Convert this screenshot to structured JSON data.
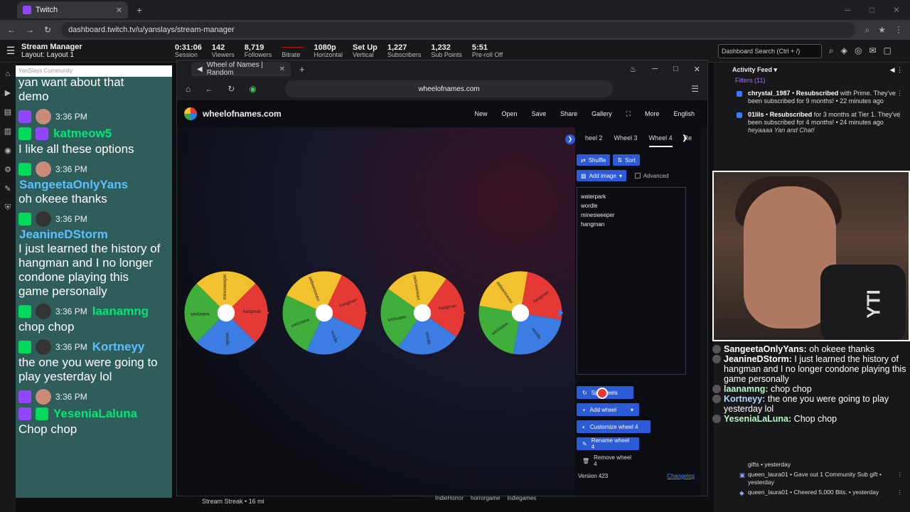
{
  "browser": {
    "tab_title": "Twitch",
    "url": "dashboard.twitch.tv/u/yanslays/stream-manager"
  },
  "header": {
    "title": "Stream Manager",
    "layout": "Layout: Layout 1",
    "stats": [
      {
        "value": "0:31:06",
        "label": "Session"
      },
      {
        "value": "142",
        "label": "Viewers"
      },
      {
        "value": "8,719",
        "label": "Followers"
      },
      {
        "value": "",
        "label": "Bitrate"
      },
      {
        "value": "1080p",
        "label": "Horizontal"
      },
      {
        "value": "Set Up",
        "label": "Vertical"
      },
      {
        "value": "1,227",
        "label": "Subscribers"
      },
      {
        "value": "1,232",
        "label": "Sub Points"
      },
      {
        "value": "5:51",
        "label": "Pre-roll Off"
      }
    ],
    "search_placeholder": "Dashboard Search (Ctrl + /)"
  },
  "chat": {
    "note": "YanSlays Community",
    "partial_text": "demo",
    "partial_top": "yan want about that",
    "messages": [
      {
        "time": "3:36 PM",
        "user": "katmeow5",
        "color": "#00e676",
        "text": "I like all these options"
      },
      {
        "time": "3:36 PM",
        "user": "SangeetaOnlyYans",
        "color": "#5bc0ff",
        "text": "oh okeee thanks"
      },
      {
        "time": "3:36 PM",
        "user": "JeanineDStorm",
        "color": "#5bc0ff",
        "text": "I just learned the history of hangman and I no longer condone playing this game personally"
      },
      {
        "time": "3:36 PM",
        "user": "laanamng",
        "color": "#00e676",
        "text": "chop chop"
      },
      {
        "time": "3:36 PM",
        "user": "Kortneyy",
        "color": "#5bc0ff",
        "text": "the one you were going to play yesterday lol"
      },
      {
        "time": "3:36 PM",
        "user": "YeseniaLaluna",
        "color": "#00e676",
        "text": "Chop chop"
      }
    ]
  },
  "inner_browser": {
    "tab_title": "Wheel of Names | Random",
    "url": "wheelofnames.com",
    "site_name": "wheelofnames.com",
    "menu": [
      "New",
      "Open",
      "Save",
      "Share",
      "Gallery",
      "More",
      "English"
    ],
    "wheel_tabs": [
      "heel 2",
      "Wheel 3",
      "Wheel 4",
      "Re"
    ],
    "shuffle": "Shuffle",
    "sort": "Sort",
    "add_image": "Add image",
    "advanced": "Advanced",
    "entries": [
      "waterpark",
      "wordle",
      "minesweeper",
      "hangman"
    ],
    "spin_wheels": "Sp      wheels",
    "add_wheel": "Add wheel",
    "customize": "Customize wheel 4",
    "rename": "Rename wheel 4",
    "remove": "Remove wheel 4",
    "version": "Version 423",
    "changelog": "Changelog",
    "wheel_labels": [
      "hangman",
      "wordle",
      "waterpark",
      "minesweeper"
    ]
  },
  "feed": {
    "title": "Activity Feed",
    "filters": "Filters (11)",
    "items": [
      {
        "user": "chrystal_1987",
        "action": "Resubscribed",
        "text": "with Prime. They've been subscribed for 9 months! • 22 minutes ago"
      },
      {
        "user": "01lils",
        "action": "Resubscribed",
        "text": "for 3 months at Tier 1. They've been subscribed for 4 months! • 24 minutes ago",
        "quote": "heyaaaa Yan and Chat!"
      }
    ]
  },
  "overlay": [
    {
      "user": "SangeetaOnlyYans:",
      "text": "oh okeee thanks",
      "color": "#ffffff"
    },
    {
      "user": "JeanineDStorm:",
      "text": "I just learned the history of hangman and I no longer condone playing this game personally",
      "color": "#ffffff"
    },
    {
      "user": "laanamng:",
      "text": "chop chop",
      "color": "#b7f7c6"
    },
    {
      "user": "Kortneyy:",
      "text": "the one you were going to play yesterday lol",
      "color": "#b7d4ff"
    },
    {
      "user": "YeseniaLaLuna:",
      "text": "Chop chop",
      "color": "#b7f7c6"
    }
  ],
  "feed_bottom": [
    {
      "text": "gifts • yesterday"
    },
    {
      "text": "queen_laura01 • Gave out 1 Community Sub gift • yesterday"
    },
    {
      "text": "queen_laura01 • Cheered 5,000 Bits. • yesterday"
    }
  ],
  "bottom_tags": [
    "IndieHorror",
    "horrorgame",
    "indiegames"
  ],
  "stream_streak": "Stream Streak • 16 mi"
}
